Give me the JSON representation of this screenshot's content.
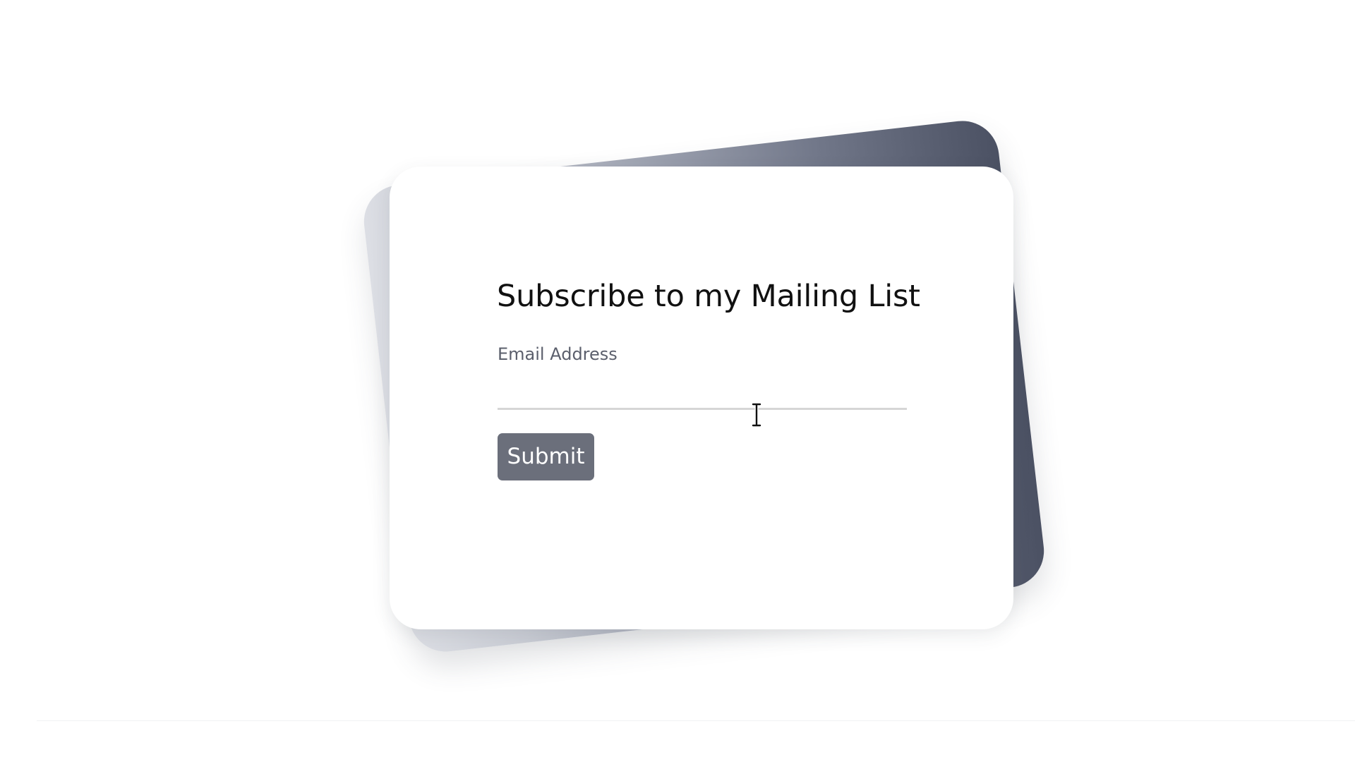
{
  "subscribe_form": {
    "title": "Subscribe to my Mailing List",
    "email_label": "Email Address",
    "email_value": "",
    "email_placeholder": "",
    "submit_label": "Submit"
  },
  "pointer": {
    "icon": "text-cursor-icon"
  },
  "colors": {
    "background": "#ffffff",
    "card": "#ffffff",
    "back_card_gradient_start": "#dcdee4",
    "back_card_gradient_end": "#4b5163",
    "button": "#6b6f7b",
    "input_underline": "#d6d6d6",
    "title_text": "#111111",
    "label_text": "#5b5f6c"
  }
}
